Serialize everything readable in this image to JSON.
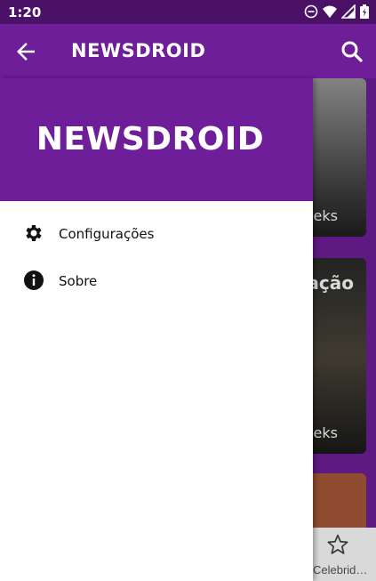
{
  "status_bar": {
    "time": "1:20",
    "icons": [
      "do-not-disturb-icon",
      "wifi-icon",
      "signal-icon",
      "battery-icon"
    ]
  },
  "app_bar": {
    "title": "NEWSDROID",
    "back_icon": "arrow-back-icon",
    "search_icon": "search-icon"
  },
  "drawer": {
    "header_title": "NEWSDROID",
    "items": [
      {
        "label": "Configurações",
        "icon": "gear-icon"
      },
      {
        "label": "Sobre",
        "icon": "info-icon"
      }
    ]
  },
  "background": {
    "cards": [
      {
        "source": "eeks"
      },
      {
        "title_fragment": "ação",
        "source": "eeks"
      }
    ],
    "bottom_nav": {
      "tab_label": "Celebrid…",
      "icon": "star-outline-icon"
    }
  },
  "colors": {
    "primary": "#6f1e99",
    "status_bar": "#4a1166",
    "drawer_background": "#ffffff"
  }
}
